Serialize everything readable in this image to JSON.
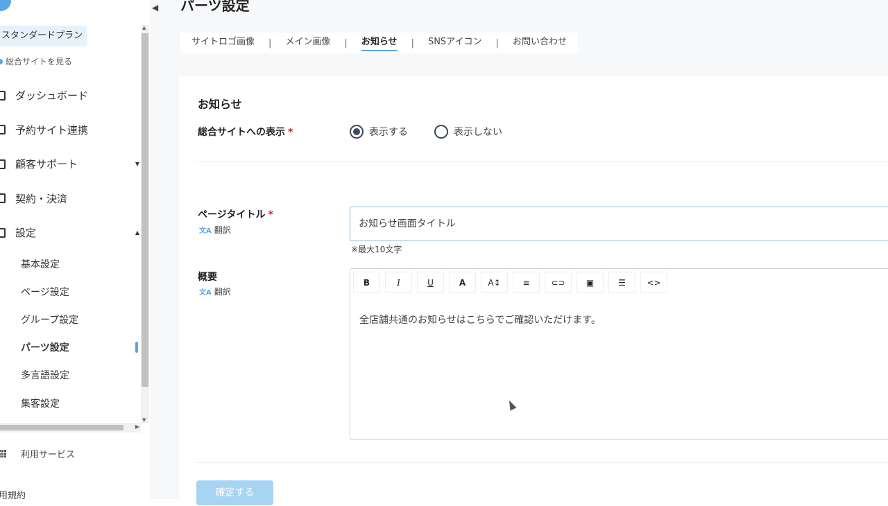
{
  "sidebar": {
    "plan": "スタンダードプラン",
    "view_site": "総合サイトを見る",
    "nav": [
      {
        "label": "ダッシュボード"
      },
      {
        "label": "予約サイト連携"
      },
      {
        "label": "顧客サポート"
      },
      {
        "label": "契約・決済"
      },
      {
        "label": "設定"
      }
    ],
    "sub_items": [
      {
        "label": "基本設定"
      },
      {
        "label": "ページ設定"
      },
      {
        "label": "グループ設定"
      },
      {
        "label": "パーツ設定"
      },
      {
        "label": "多言語設定"
      },
      {
        "label": "集客設定"
      }
    ],
    "services": "利用サービス",
    "terms": "用規約"
  },
  "main": {
    "page_title": "パーツ設定",
    "tabs": [
      {
        "label": "サイトロゴ画像"
      },
      {
        "label": "メイン画像"
      },
      {
        "label": "お知らせ"
      },
      {
        "label": "SNSアイコン"
      },
      {
        "label": "お問い合わせ"
      }
    ],
    "tab_separator": "|",
    "section_title": "お知らせ",
    "display_label": "総合サイトへの表示",
    "required_mark": "*",
    "radio_options": [
      {
        "label": "表示する",
        "checked": true
      },
      {
        "label": "表示しない",
        "checked": false
      }
    ],
    "page_title_label": "ページタイトル",
    "translate": "翻訳",
    "page_title_value": "お知らせ画面タイトル",
    "page_title_hint": "※最大10文字",
    "summary_label": "概要",
    "toolbar": [
      "B",
      "I",
      "U",
      "A",
      "A↕",
      "≡",
      "⊂⊃",
      "▣",
      "☰",
      "<>"
    ],
    "editor_text": "全店舗共通のお知らせはこちらでご確認いただけます。",
    "confirm_label": "確定する"
  },
  "colors": {
    "accent": "#5aa7e6",
    "required": "#d0202b",
    "button_disabled": "#a8d4f4"
  }
}
